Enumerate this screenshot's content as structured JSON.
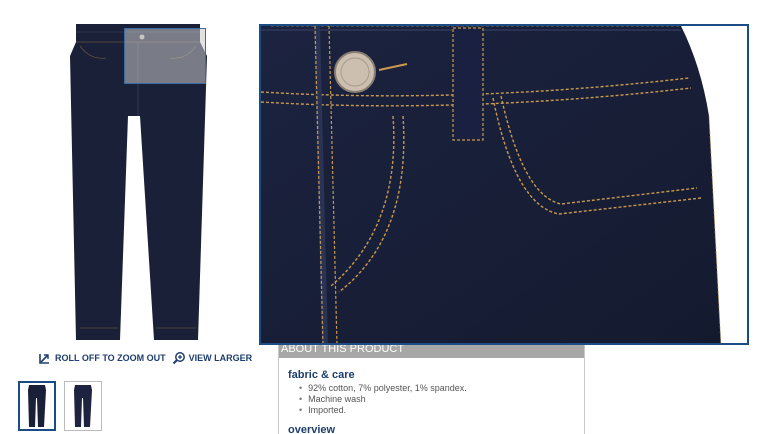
{
  "zoom_tools": {
    "roll_off_label": "ROLL OFF TO ZOOM OUT",
    "view_larger_label": "VIEW LARGER"
  },
  "about": {
    "header": "ABOUT THIS PRODUCT",
    "fabric_title": "fabric & care",
    "fabric_items": [
      "92% cotton, 7% polyester, 1% spandex.",
      "Machine wash",
      "Imported."
    ],
    "overview_label": "overview"
  },
  "colors": {
    "denim": "#1a2038",
    "stitch": "#c99a4e",
    "accent": "#1b4c85"
  }
}
